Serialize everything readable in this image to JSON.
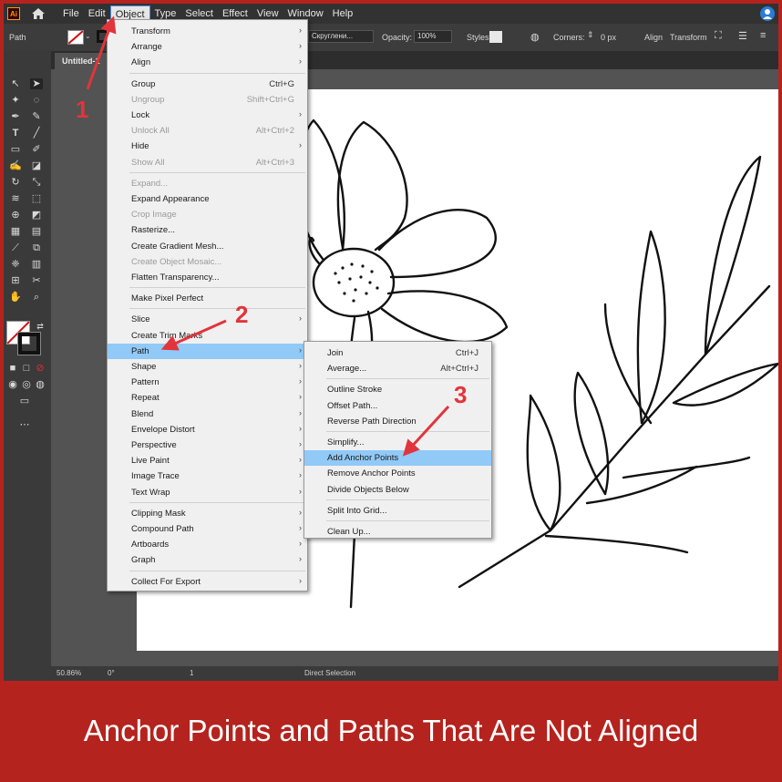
{
  "app": {
    "logo": "Ai",
    "home_icon": "home-icon",
    "account_icon": "account-icon"
  },
  "menubar": [
    "File",
    "Edit",
    "Object",
    "Type",
    "Select",
    "Effect",
    "View",
    "Window",
    "Help"
  ],
  "controlbar": {
    "selection_label": "Path",
    "brush_field": "Скруглени...",
    "opacity_label": "Opacity:",
    "opacity_value": "100%",
    "styles_label": "Styles",
    "corners_label": "Corners:",
    "corners_value": "0 px",
    "align_label": "Align",
    "transform_label": "Transform"
  },
  "doc_tab": "Untitled-1",
  "object_menu": [
    {
      "label": "Transform",
      "shortcut": "",
      "submenu": true,
      "disabled": false
    },
    {
      "label": "Arrange",
      "shortcut": "",
      "submenu": true,
      "disabled": false
    },
    {
      "label": "Align",
      "shortcut": "",
      "submenu": true,
      "disabled": false
    },
    {
      "label": "Group",
      "shortcut": "Ctrl+G",
      "submenu": false,
      "disabled": false
    },
    {
      "label": "Ungroup",
      "shortcut": "Shift+Ctrl+G",
      "submenu": false,
      "disabled": true
    },
    {
      "label": "Lock",
      "shortcut": "",
      "submenu": true,
      "disabled": false
    },
    {
      "label": "Unlock All",
      "shortcut": "Alt+Ctrl+2",
      "submenu": false,
      "disabled": true
    },
    {
      "label": "Hide",
      "shortcut": "",
      "submenu": true,
      "disabled": false
    },
    {
      "label": "Show All",
      "shortcut": "Alt+Ctrl+3",
      "submenu": false,
      "disabled": true
    },
    {
      "label": "Expand...",
      "shortcut": "",
      "submenu": false,
      "disabled": true
    },
    {
      "label": "Expand Appearance",
      "shortcut": "",
      "submenu": false,
      "disabled": false
    },
    {
      "label": "Crop Image",
      "shortcut": "",
      "submenu": false,
      "disabled": true
    },
    {
      "label": "Rasterize...",
      "shortcut": "",
      "submenu": false,
      "disabled": false
    },
    {
      "label": "Create Gradient Mesh...",
      "shortcut": "",
      "submenu": false,
      "disabled": false
    },
    {
      "label": "Create Object Mosaic...",
      "shortcut": "",
      "submenu": false,
      "disabled": true
    },
    {
      "label": "Flatten Transparency...",
      "shortcut": "",
      "submenu": false,
      "disabled": false
    },
    {
      "label": "Make Pixel Perfect",
      "shortcut": "",
      "submenu": false,
      "disabled": false
    },
    {
      "label": "Slice",
      "shortcut": "",
      "submenu": true,
      "disabled": false
    },
    {
      "label": "Create Trim Marks",
      "shortcut": "",
      "submenu": false,
      "disabled": false
    },
    {
      "label": "Path",
      "shortcut": "",
      "submenu": true,
      "disabled": false,
      "highlighted": true
    },
    {
      "label": "Shape",
      "shortcut": "",
      "submenu": true,
      "disabled": false
    },
    {
      "label": "Pattern",
      "shortcut": "",
      "submenu": true,
      "disabled": false
    },
    {
      "label": "Repeat",
      "shortcut": "",
      "submenu": true,
      "disabled": false
    },
    {
      "label": "Blend",
      "shortcut": "",
      "submenu": true,
      "disabled": false
    },
    {
      "label": "Envelope Distort",
      "shortcut": "",
      "submenu": true,
      "disabled": false
    },
    {
      "label": "Perspective",
      "shortcut": "",
      "submenu": true,
      "disabled": false
    },
    {
      "label": "Live Paint",
      "shortcut": "",
      "submenu": true,
      "disabled": false
    },
    {
      "label": "Image Trace",
      "shortcut": "",
      "submenu": true,
      "disabled": false
    },
    {
      "label": "Text Wrap",
      "shortcut": "",
      "submenu": true,
      "disabled": false
    },
    {
      "label": "Clipping Mask",
      "shortcut": "",
      "submenu": true,
      "disabled": false
    },
    {
      "label": "Compound Path",
      "shortcut": "",
      "submenu": true,
      "disabled": false
    },
    {
      "label": "Artboards",
      "shortcut": "",
      "submenu": true,
      "disabled": false
    },
    {
      "label": "Graph",
      "shortcut": "",
      "submenu": true,
      "disabled": false
    },
    {
      "label": "Collect For Export",
      "shortcut": "",
      "submenu": true,
      "disabled": false
    }
  ],
  "path_submenu": [
    {
      "label": "Join",
      "shortcut": "Ctrl+J"
    },
    {
      "label": "Average...",
      "shortcut": "Alt+Ctrl+J"
    },
    {
      "label": "Outline Stroke",
      "shortcut": ""
    },
    {
      "label": "Offset Path...",
      "shortcut": ""
    },
    {
      "label": "Reverse Path Direction",
      "shortcut": ""
    },
    {
      "label": "Simplify...",
      "shortcut": ""
    },
    {
      "label": "Add Anchor Points",
      "shortcut": "",
      "highlighted": true
    },
    {
      "label": "Remove Anchor Points",
      "shortcut": ""
    },
    {
      "label": "Divide Objects Below",
      "shortcut": ""
    },
    {
      "label": "Split Into Grid...",
      "shortcut": ""
    },
    {
      "label": "Clean Up...",
      "shortcut": ""
    }
  ],
  "statusbar": {
    "zoom": "50.86%",
    "rotate": "0°",
    "artboard": "1",
    "tool": "Direct Selection"
  },
  "annotations": [
    "1",
    "2",
    "3"
  ],
  "caption": "Anchor Points and Paths That Are Not Aligned",
  "colors": {
    "frame": "#b5231e",
    "annotation": "#e2343b",
    "highlight": "#91c9f7"
  }
}
